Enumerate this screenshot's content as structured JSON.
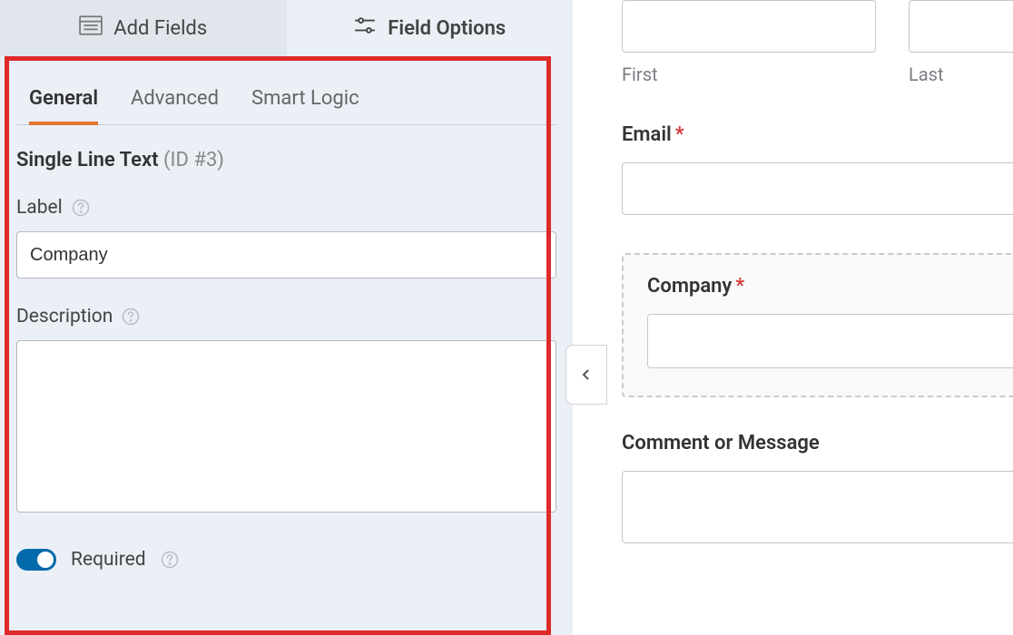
{
  "mainTabs": {
    "addFields": "Add Fields",
    "fieldOptions": "Field Options"
  },
  "subTabs": {
    "general": "General",
    "advanced": "Advanced",
    "smartLogic": "Smart Logic"
  },
  "fieldHeader": {
    "type": "Single Line Text",
    "id": "(ID #3)"
  },
  "labels": {
    "label": "Label",
    "description": "Description",
    "required": "Required"
  },
  "values": {
    "labelValue": "Company",
    "descriptionValue": ""
  },
  "toggles": {
    "required": true
  },
  "preview": {
    "first": "First",
    "last": "Last",
    "email": "Email",
    "company": "Company",
    "comment": "Comment or Message",
    "star": "*"
  }
}
